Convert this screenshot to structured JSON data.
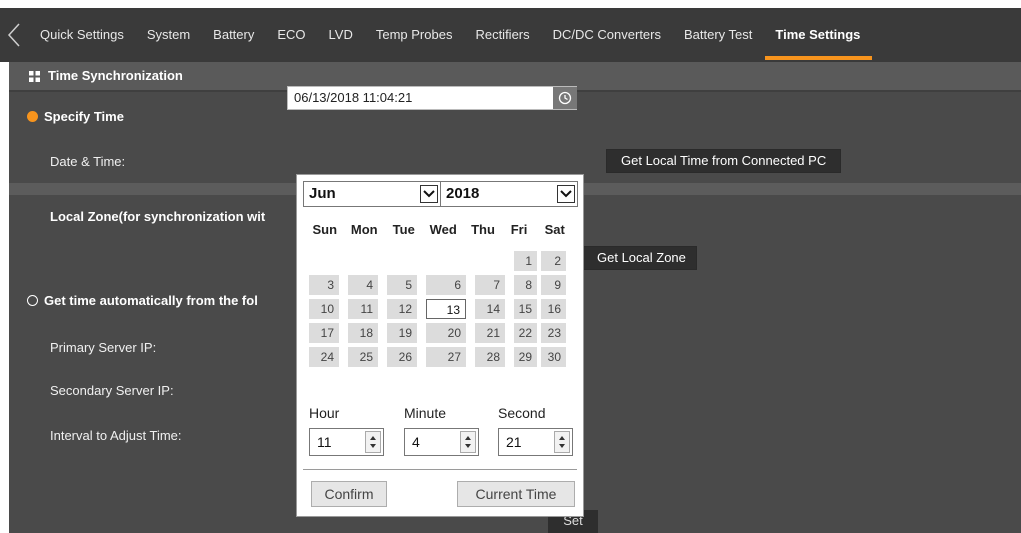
{
  "nav": {
    "tabs": [
      {
        "label": "Quick Settings"
      },
      {
        "label": "System"
      },
      {
        "label": "Battery"
      },
      {
        "label": "ECO"
      },
      {
        "label": "LVD"
      },
      {
        "label": "Temp Probes"
      },
      {
        "label": "Rectifiers"
      },
      {
        "label": "DC/DC Converters"
      },
      {
        "label": "Battery Test"
      },
      {
        "label": "Time Settings"
      }
    ],
    "active_index": 9
  },
  "section": {
    "title": "Time Synchronization"
  },
  "specify_time": {
    "label": "Specify Time",
    "date_time_label": "Date & Time:",
    "date_time_value": "06/13/2018 11:04:21",
    "get_local_time_button": "Get Local Time from Connected PC"
  },
  "local_zone": {
    "label": "Local Zone(for synchronization wit",
    "get_local_zone_button": "Get Local Zone"
  },
  "auto_time": {
    "label": "Get time automatically from the fol",
    "primary_label": "Primary Server IP:",
    "secondary_label": "Secondary Server IP:",
    "interval_label": "Interval to Adjust Time:",
    "set_button": "Set"
  },
  "calendar": {
    "month": "Jun",
    "year": "2018",
    "weekdays": [
      "Sun",
      "Mon",
      "Tue",
      "Wed",
      "Thu",
      "Fri",
      "Sat"
    ],
    "days": [
      "1",
      "2",
      "3",
      "4",
      "5",
      "6",
      "7",
      "8",
      "9",
      "10",
      "11",
      "12",
      "13",
      "14",
      "15",
      "16",
      "17",
      "18",
      "19",
      "20",
      "21",
      "22",
      "23",
      "24",
      "25",
      "26",
      "27",
      "28",
      "29",
      "30"
    ],
    "first_weekday_index": 5,
    "selected_day": "13",
    "hour_label": "Hour",
    "minute_label": "Minute",
    "second_label": "Second",
    "hour": "11",
    "minute": "4",
    "second": "21",
    "confirm_button": "Confirm",
    "current_time_button": "Current Time"
  },
  "colors": {
    "accent": "#f7941d",
    "nav_bg": "#3a3a3a",
    "panel_bg": "#4a4a4a"
  }
}
